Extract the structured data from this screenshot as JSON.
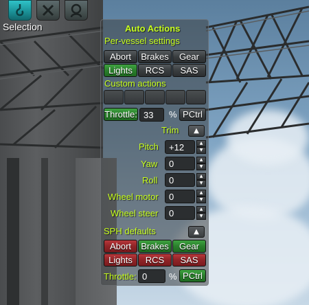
{
  "colors": {
    "accent_text": "#c8ff1e",
    "toolbar_active": "#1a8f95",
    "button_green": "#2a7f2c",
    "button_red": "#8f2427",
    "button_gray": "#3a3e40"
  },
  "toolbar": {
    "icons": [
      "crane-hook-icon",
      "wrench-crossed-icon",
      "kerbal-portrait-icon"
    ],
    "selection_label": "Selection"
  },
  "panel": {
    "title": "Auto Actions",
    "per_vessel": {
      "heading": "Per-vessel settings",
      "buttons": [
        {
          "label": "Abort",
          "state": "off"
        },
        {
          "label": "Brakes",
          "state": "off"
        },
        {
          "label": "Gear",
          "state": "off"
        },
        {
          "label": "Lights",
          "state": "on"
        },
        {
          "label": "RCS",
          "state": "off"
        },
        {
          "label": "SAS",
          "state": "off"
        }
      ]
    },
    "custom_actions": {
      "heading": "Custom actions",
      "slot_count": 5
    },
    "throttle": {
      "label": "Throttle:",
      "value": "33",
      "unit": "%",
      "pctrl": "PCtrl"
    },
    "trim": {
      "label": "Trim",
      "toggle": "▲",
      "rows": [
        {
          "label": "Pitch",
          "value": "+12"
        },
        {
          "label": "Yaw",
          "value": "0"
        },
        {
          "label": "Roll",
          "value": "0"
        },
        {
          "label": "Wheel motor",
          "value": "0"
        },
        {
          "label": "Wheel steer",
          "value": "0"
        }
      ]
    },
    "sph_defaults": {
      "heading": "SPH defaults",
      "toggle": "▲",
      "buttons": [
        {
          "label": "Abort",
          "state": "red"
        },
        {
          "label": "Brakes",
          "state": "green"
        },
        {
          "label": "Gear",
          "state": "green"
        },
        {
          "label": "Lights",
          "state": "red"
        },
        {
          "label": "RCS",
          "state": "red"
        },
        {
          "label": "SAS",
          "state": "red"
        }
      ],
      "throttle": {
        "label": "Throttle:",
        "value": "0",
        "unit": "%",
        "pctrl": "PCtrl"
      }
    }
  }
}
